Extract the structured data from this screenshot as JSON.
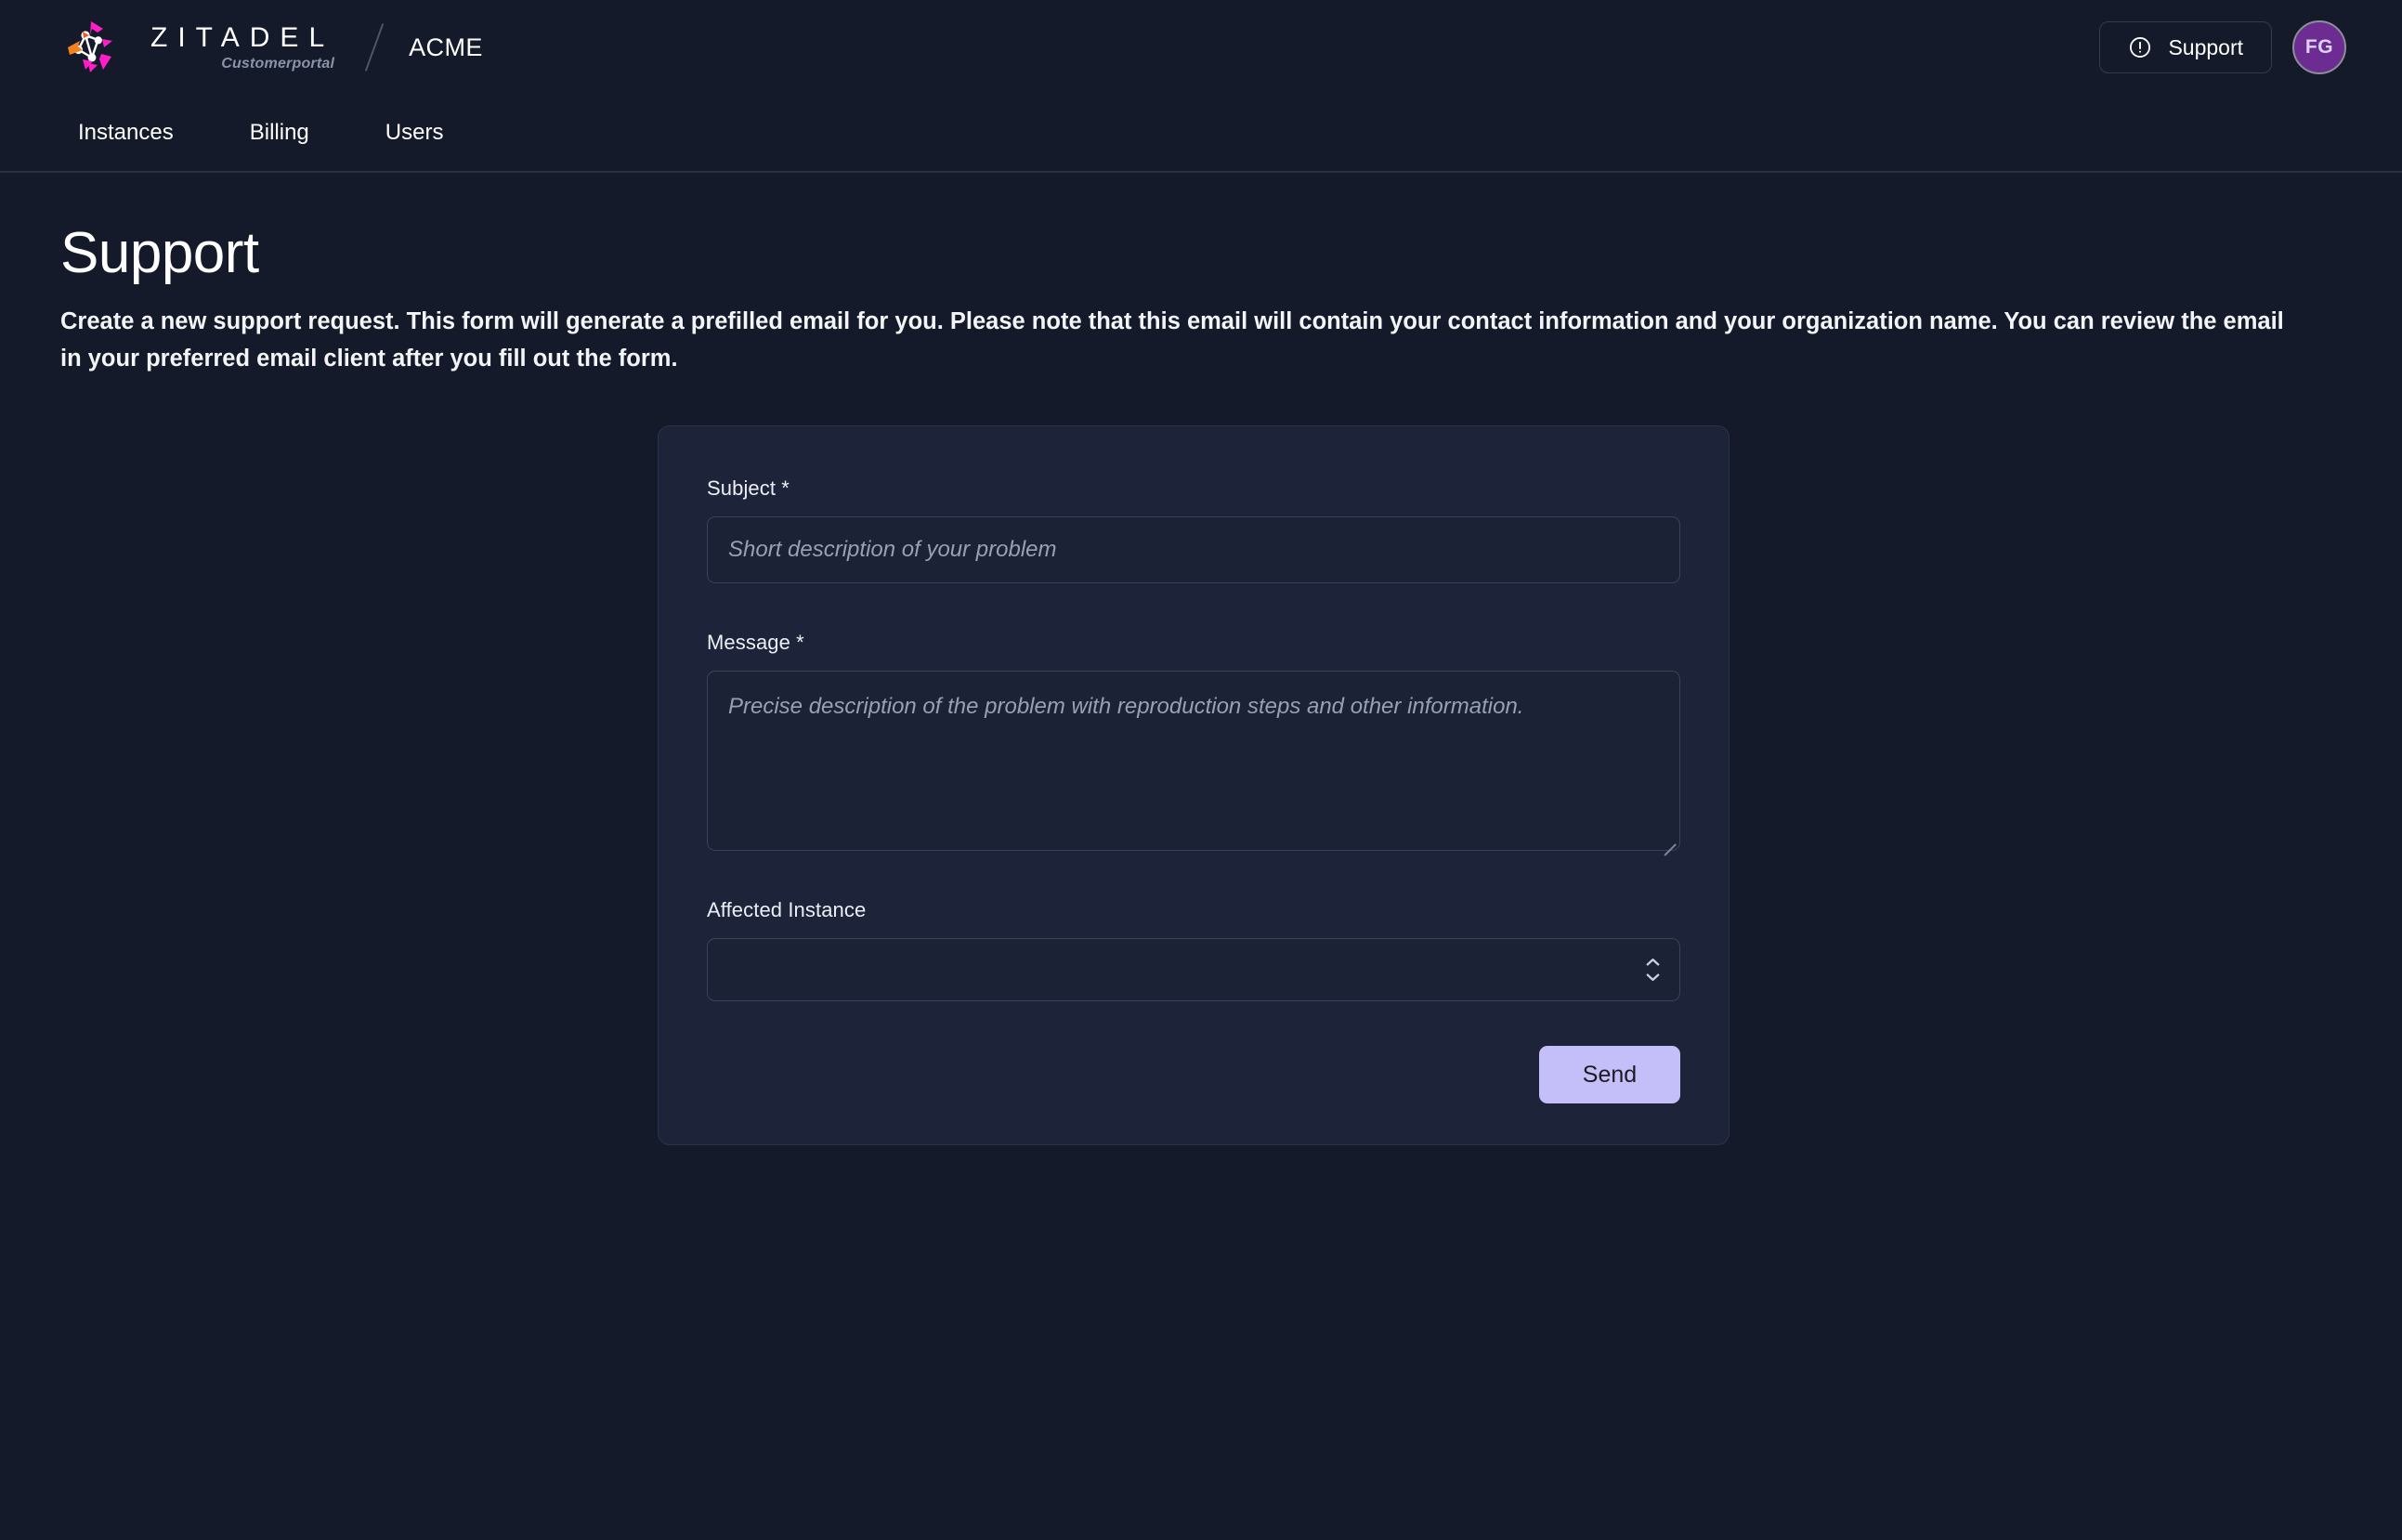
{
  "header": {
    "logo_word": "ZITADEL",
    "logo_sub": "Customerportal",
    "org_name": "ACME",
    "support_label": "Support",
    "avatar_initials": "FG"
  },
  "nav": {
    "items": [
      {
        "label": "Instances"
      },
      {
        "label": "Billing"
      },
      {
        "label": "Users"
      }
    ]
  },
  "page": {
    "title": "Support",
    "description": "Create a new support request. This form will generate a prefilled email for you. Please note that this email will contain your contact information and your organization name. You can review the email in your preferred email client after you fill out the form."
  },
  "form": {
    "subject": {
      "label": "Subject *",
      "placeholder": "Short description of your problem",
      "value": ""
    },
    "message": {
      "label": "Message *",
      "placeholder": "Precise description of the problem with reproduction steps and other information.",
      "value": ""
    },
    "affected_instance": {
      "label": "Affected Instance",
      "selected": "",
      "options": [
        ""
      ]
    },
    "submit_label": "Send"
  },
  "colors": {
    "page_background": "#141a29",
    "card_background": "#1d2439",
    "input_background": "#1b2236",
    "accent_button": "#c5bff9",
    "avatar_purple": "#6d2c92",
    "logo_pink": "#ff1ec8",
    "logo_orange": "#f5821f"
  }
}
